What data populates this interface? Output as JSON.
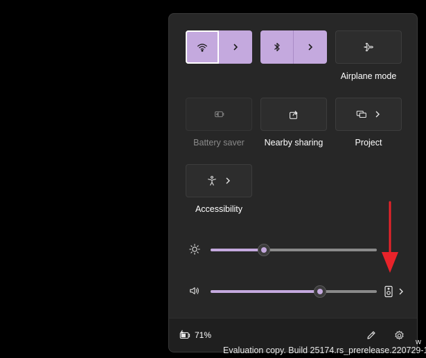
{
  "quick_settings": {
    "tiles": {
      "wifi": {
        "icon": "wifi-icon"
      },
      "bluetooth": {
        "icon": "bluetooth-icon"
      },
      "airplane": {
        "label": "Airplane mode",
        "icon": "airplane-icon"
      },
      "battery_saver": {
        "label": "Battery saver",
        "icon": "battery-saver-icon"
      },
      "nearby_sharing": {
        "label": "Nearby sharing",
        "icon": "share-icon"
      },
      "project": {
        "label": "Project",
        "icon": "project-icon"
      },
      "accessibility": {
        "label": "Accessibility",
        "icon": "accessibility-icon"
      }
    },
    "brightness": {
      "icon": "brightness-icon",
      "level": 0.32
    },
    "volume": {
      "icon": "speaker-icon",
      "level": 0.66,
      "output_icon": "audio-output-icon"
    }
  },
  "footer": {
    "battery_percent": "71%",
    "battery_icon": "battery-charging-icon",
    "edit_icon": "pencil-icon",
    "settings_icon": "gear-icon"
  },
  "watermark": {
    "text": "Evaluation copy. Build 25174.rs_prerelease.220729-1429",
    "trailing": "w"
  },
  "colors": {
    "accent": "#c4a9de",
    "panel": "#272727",
    "footer": "#1f1f1f",
    "annotation_arrow": "#e8232a"
  }
}
